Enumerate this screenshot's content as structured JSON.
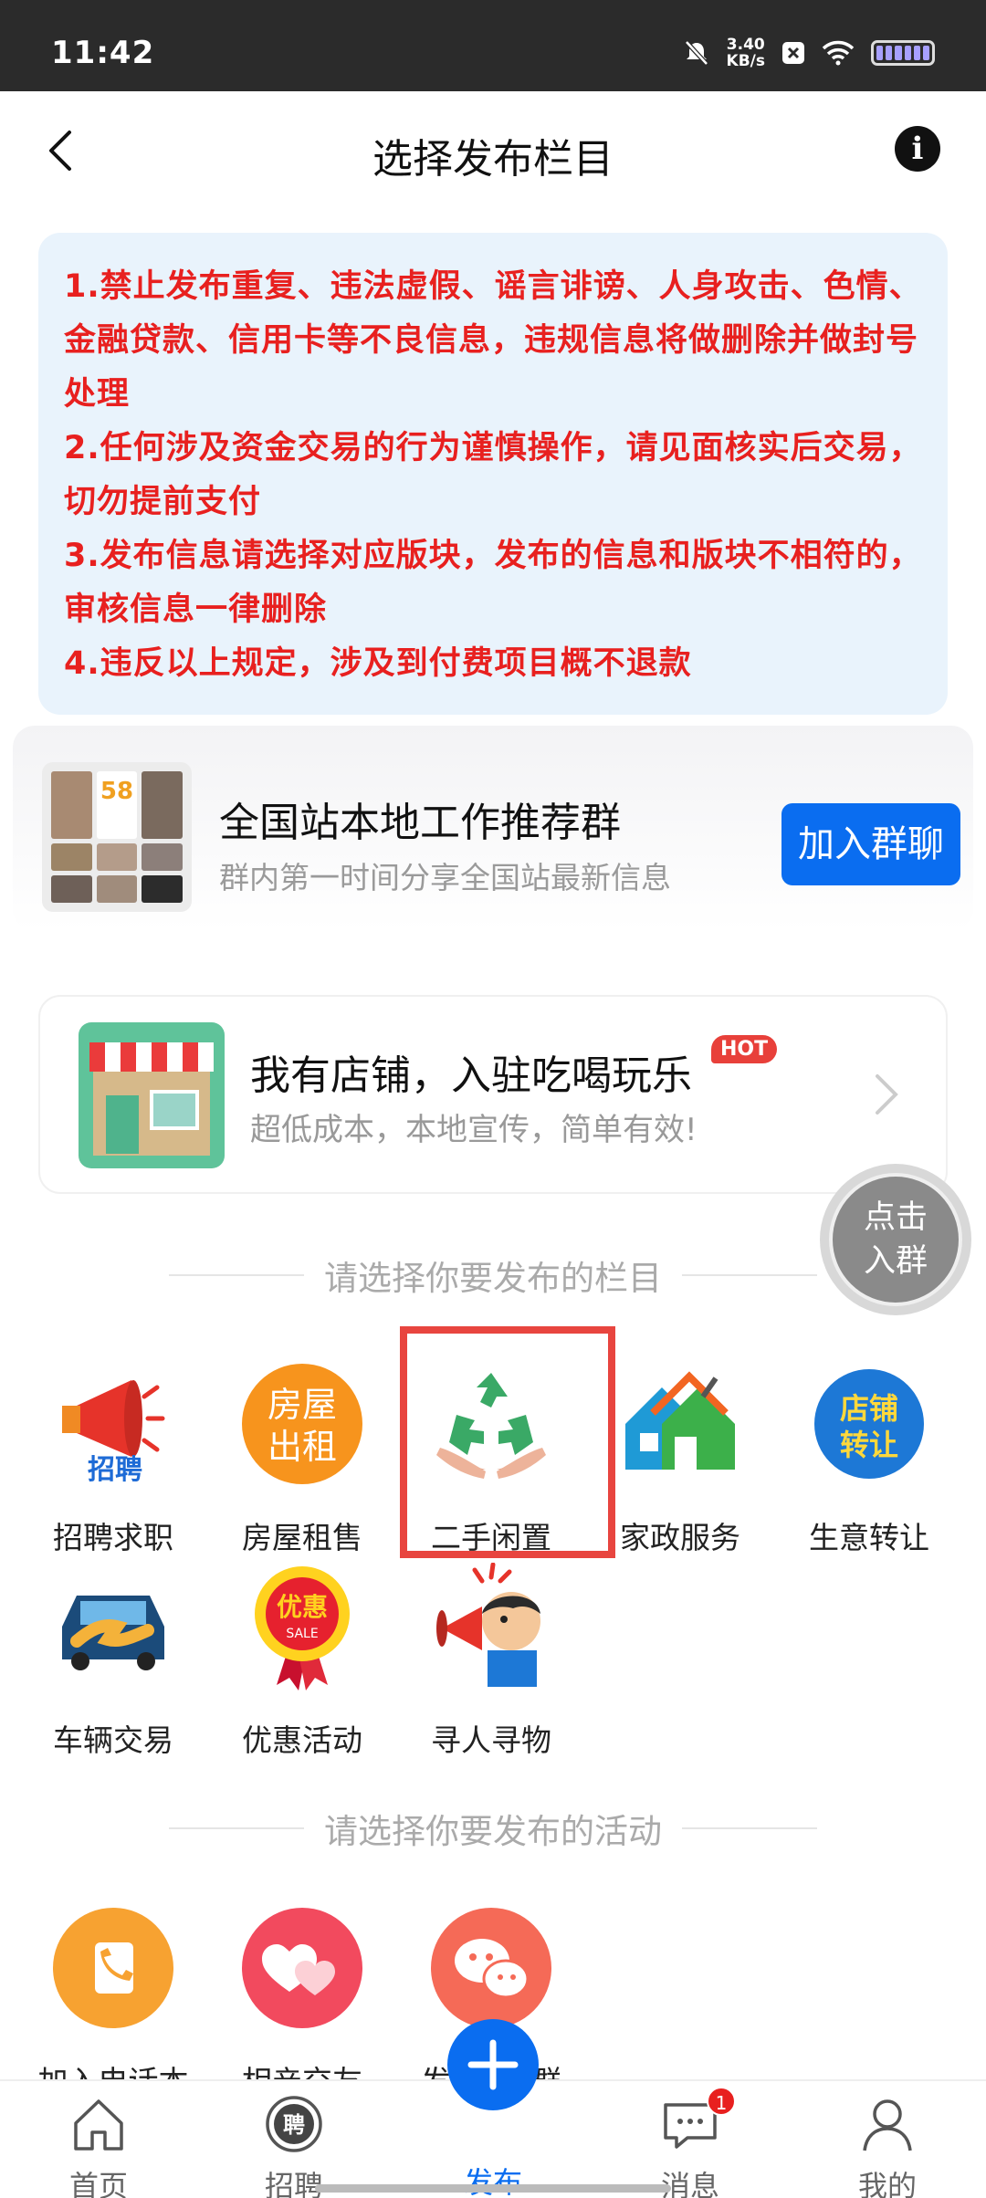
{
  "status_bar": {
    "time": "11:42",
    "net_speed_value": "3.40",
    "net_speed_unit": "KB/s"
  },
  "header": {
    "title": "选择发布栏目"
  },
  "rules": [
    "1.禁止发布重复、违法虚假、谣言诽谤、人身攻击、色情、金融贷款、信用卡等不良信息，违规信息将做删除并做封号处理",
    "2.任何涉及资金交易的行为谨慎操作，请见面核实后交易，切勿提前支付",
    "3.发布信息请选择对应版块，发布的信息和版块不相符的，审核信息一律删除",
    "4.违反以上规定，涉及到付费项目概不退款"
  ],
  "group_card": {
    "avatar_logo": "58",
    "title": "全国站本地工作推荐群",
    "subtitle": "群内第一时间分享全国站最新信息",
    "join_label": "加入群聊"
  },
  "store_card": {
    "title": "我有店铺，入驻吃喝玩乐",
    "hot_badge": "HOT",
    "subtitle": "超低成本，本地宣传，简单有效!"
  },
  "float_button": {
    "line1": "点击",
    "line2": "入群"
  },
  "section_columns": {
    "heading": "请选择你要发布的栏目",
    "items": [
      {
        "label": "招聘求职",
        "icon": "megaphone-hire-icon",
        "icon_text": "招聘"
      },
      {
        "label": "房屋租售",
        "icon": "house-rent-icon",
        "icon_text_1": "房屋",
        "icon_text_2": "出租"
      },
      {
        "label": "二手闲置",
        "icon": "recycle-hands-icon"
      },
      {
        "label": "家政服务",
        "icon": "home-service-icon"
      },
      {
        "label": "生意转让",
        "icon": "shop-transfer-icon",
        "icon_text_1": "店铺",
        "icon_text_2": "转让"
      },
      {
        "label": "车辆交易",
        "icon": "car-deal-icon"
      },
      {
        "label": "优惠活动",
        "icon": "sale-medal-icon",
        "icon_text_1": "优惠",
        "icon_text_2": "SALE"
      },
      {
        "label": "寻人寻物",
        "icon": "search-person-icon"
      }
    ]
  },
  "section_activities": {
    "heading": "请选择你要发布的活动",
    "items": [
      {
        "label": "加入电话本",
        "icon": "phonebook-icon",
        "color": "#f7a231"
      },
      {
        "label": "相亲交友",
        "icon": "hearts-icon",
        "color": "#f24a5e"
      },
      {
        "label": "发",
        "icon": "wechat-group-icon",
        "color": "#f56a57"
      }
    ],
    "third_label_tail": "群"
  },
  "bottom_nav": {
    "items": [
      {
        "label": "首页",
        "icon": "home-icon"
      },
      {
        "label": "招聘",
        "icon": "hire-icon",
        "icon_text": "聘"
      },
      {
        "label": "发布",
        "icon": "plus-icon"
      },
      {
        "label": "消息",
        "icon": "message-icon"
      },
      {
        "label": "我的",
        "icon": "person-icon"
      }
    ],
    "message_badge": "1"
  },
  "colors": {
    "accent_blue": "#0a6df0",
    "rule_red": "#e8201f",
    "rules_bg": "#e9f3fc",
    "highlight_red": "#e8453f"
  }
}
